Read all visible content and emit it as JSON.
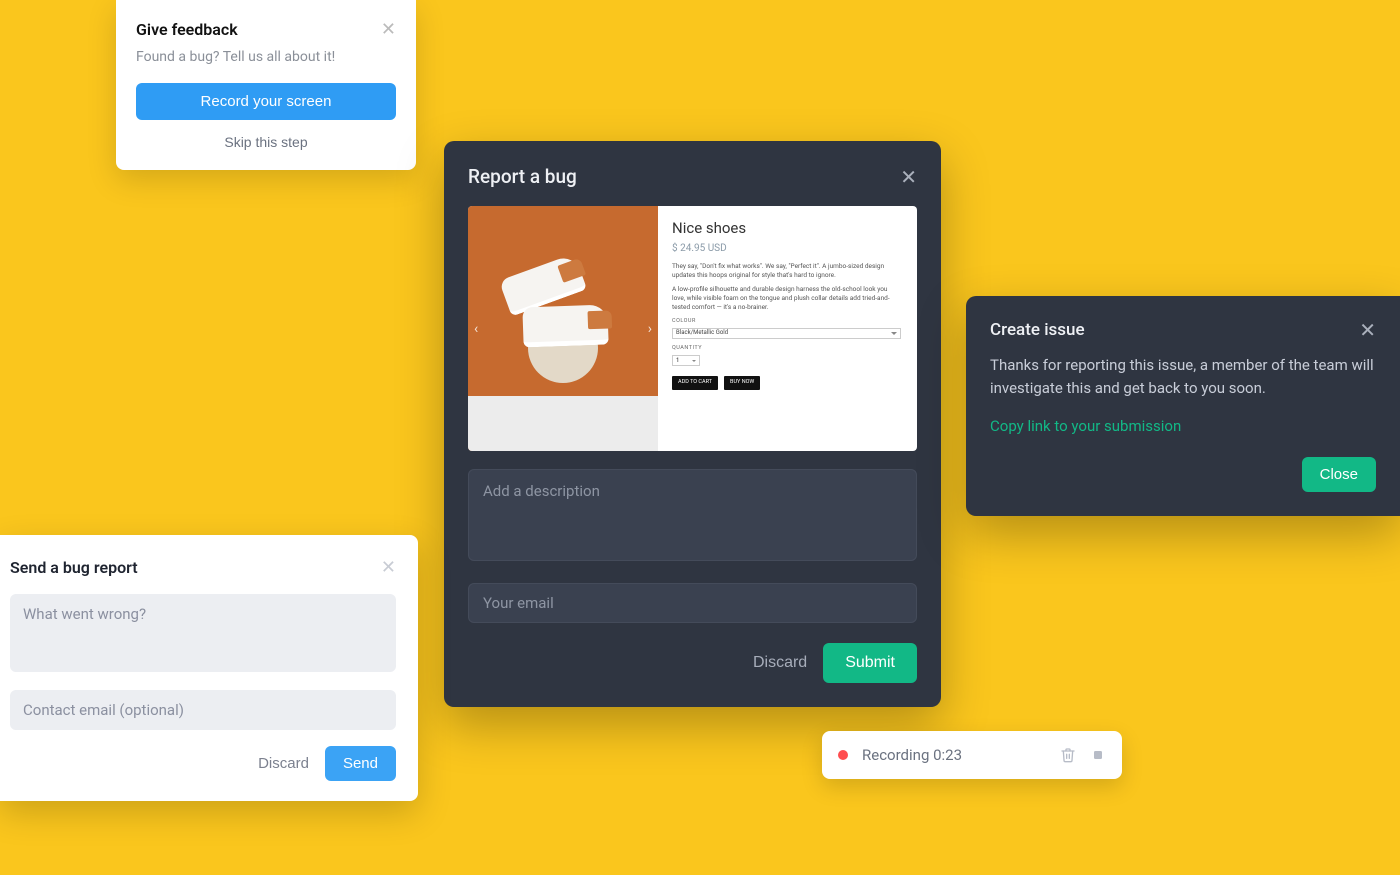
{
  "feedback": {
    "title": "Give feedback",
    "subtitle": "Found a bug? Tell us all about it!",
    "record_label": "Record your screen",
    "skip_label": "Skip this step"
  },
  "report": {
    "title": "Report a bug",
    "screenshot": {
      "product_title": "Nice shoes",
      "price": "$ 24.95 USD",
      "desc1": "They say, \"Don't fix what works\". We say, \"Perfect it\". A jumbo-sized design updates this hoops original for style that's hard to ignore.",
      "desc2": "A low-profile silhouette and durable design harness the old-school look you love, while visible foam on the tongue and plush collar details add tried-and-tested comfort — it's a no-brainer.",
      "colour_label": "COLOUR",
      "colour_value": "Black/Metallic Gold",
      "quantity_label": "QUANTITY",
      "quantity_value": "1",
      "add_to_cart": "ADD TO CART",
      "buy_now": "BUY NOW"
    },
    "description_placeholder": "Add a description",
    "email_placeholder": "Your email",
    "discard_label": "Discard",
    "submit_label": "Submit"
  },
  "issue": {
    "title": "Create issue",
    "body": "Thanks for reporting this issue, a member of the team will investigate this and get back to you soon.",
    "link_label": "Copy link to your submission",
    "close_label": "Close"
  },
  "send": {
    "title": "Send a bug report",
    "placeholder": "What went wrong?",
    "email_placeholder": "Contact email (optional)",
    "discard_label": "Discard",
    "send_label": "Send"
  },
  "recording": {
    "text": "Recording 0:23"
  }
}
